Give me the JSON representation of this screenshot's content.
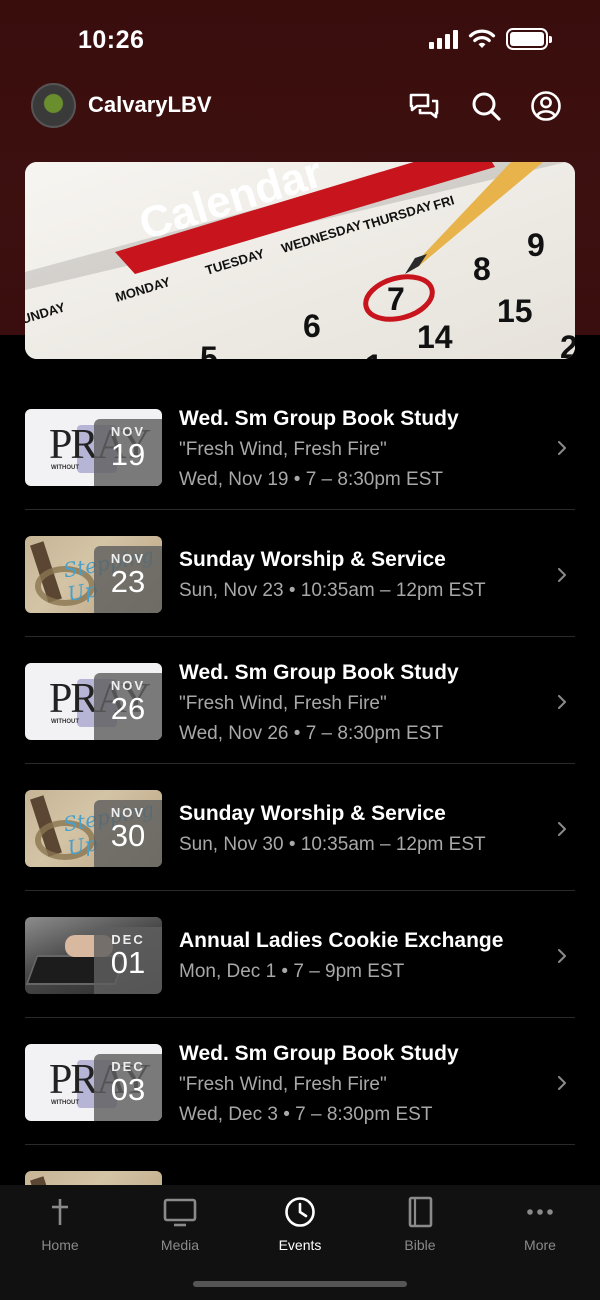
{
  "status_bar": {
    "time": "10:26"
  },
  "header": {
    "app_name": "CalvaryLBV",
    "icons": [
      "messages-icon",
      "search-icon",
      "profile-icon"
    ]
  },
  "banner": {
    "calendar_title": "Calendar",
    "weekdays": [
      "UNDAY",
      "MONDAY",
      "TUESDAY",
      "WEDNESDAY",
      "THURSDAY",
      "FRI"
    ],
    "numbers": [
      "5",
      "6",
      "7",
      "8",
      "9",
      "14",
      "15",
      "1",
      "2"
    ]
  },
  "events": [
    {
      "thumb": "pray",
      "month": "NOV",
      "day": "19",
      "title": "Wed. Sm Group Book Study",
      "subtitle": "\"Fresh Wind, Fresh Fire\"",
      "when": "Wed, Nov 19 • 7 – 8:30pm EST"
    },
    {
      "thumb": "steps",
      "month": "NOV",
      "day": "23",
      "title": "Sunday Worship & Service",
      "subtitle": "",
      "when": "Sun, Nov 23 • 10:35am – 12pm EST"
    },
    {
      "thumb": "pray",
      "month": "NOV",
      "day": "26",
      "title": "Wed. Sm Group Book Study",
      "subtitle": "\"Fresh Wind, Fresh Fire\"",
      "when": "Wed, Nov 26 • 7 – 8:30pm EST"
    },
    {
      "thumb": "steps",
      "month": "NOV",
      "day": "30",
      "title": "Sunday Worship & Service",
      "subtitle": "",
      "when": "Sun, Nov 30 • 10:35am – 12pm EST"
    },
    {
      "thumb": "cookie",
      "month": "DEC",
      "day": "01",
      "title": "Annual Ladies Cookie Exchange",
      "subtitle": "",
      "when": "Mon, Dec 1 • 7 – 9pm EST"
    },
    {
      "thumb": "pray",
      "month": "DEC",
      "day": "03",
      "title": "Wed. Sm Group Book Study",
      "subtitle": "\"Fresh Wind, Fresh Fire\"",
      "when": "Wed, Dec 3 • 7 – 8:30pm EST"
    }
  ],
  "thumb_text": {
    "pray": "PRAY",
    "pray_sub": "WITHOUT",
    "steps": "Stepping Up"
  },
  "tabs": [
    {
      "label": "Home",
      "icon": "cross-icon",
      "active": false
    },
    {
      "label": "Media",
      "icon": "tv-icon",
      "active": false
    },
    {
      "label": "Events",
      "icon": "clock-icon",
      "active": true
    },
    {
      "label": "Bible",
      "icon": "book-icon",
      "active": false
    },
    {
      "label": "More",
      "icon": "more-dots-icon",
      "active": false
    }
  ],
  "colors": {
    "header_bg": "#3d1010",
    "calendar_red": "#c8141c",
    "muted_text": "#a8a8a8",
    "tab_inactive": "#8a8a8a"
  }
}
